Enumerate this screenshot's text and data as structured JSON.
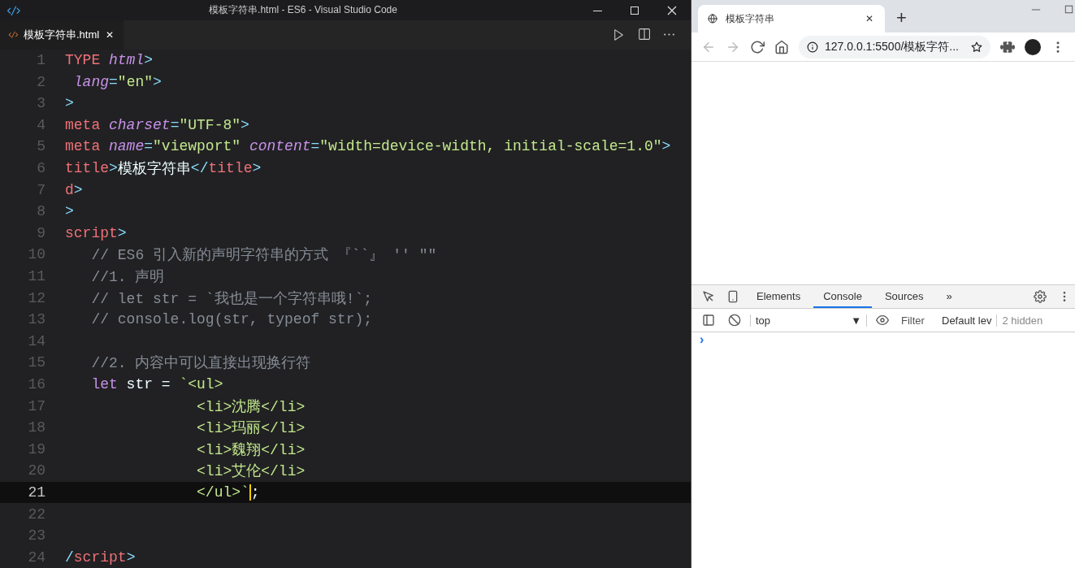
{
  "editor": {
    "window": {
      "title": "模板字符串.html - ES6 - Visual Studio Code"
    },
    "tabs": [
      {
        "label": "模板字符串.html",
        "selected": true,
        "close": "✕"
      }
    ],
    "lines": [
      {
        "number": "1",
        "current": false,
        "tokens": [
          {
            "t": "TYPE ",
            "kind": "tag"
          },
          {
            "t": "html",
            "kind": "attr"
          },
          {
            "t": ">",
            "kind": "punct"
          }
        ]
      },
      {
        "number": "2",
        "current": false,
        "tokens": [
          {
            "t": " lang",
            "kind": "attr"
          },
          {
            "t": "=",
            "kind": "punct"
          },
          {
            "t": "\"en\"",
            "kind": "string"
          },
          {
            "t": ">",
            "kind": "punct"
          }
        ]
      },
      {
        "number": "3",
        "current": false,
        "tokens": [
          {
            "t": ">",
            "kind": "punct"
          }
        ]
      },
      {
        "number": "4",
        "current": false,
        "tokens": [
          {
            "t": "meta ",
            "kind": "tag"
          },
          {
            "t": "charset",
            "kind": "attr"
          },
          {
            "t": "=",
            "kind": "punct"
          },
          {
            "t": "\"UTF-8\"",
            "kind": "string"
          },
          {
            "t": ">",
            "kind": "punct"
          }
        ]
      },
      {
        "number": "5",
        "current": false,
        "tokens": [
          {
            "t": "meta ",
            "kind": "tag"
          },
          {
            "t": "name",
            "kind": "attr"
          },
          {
            "t": "=",
            "kind": "punct"
          },
          {
            "t": "\"viewport\" ",
            "kind": "string"
          },
          {
            "t": "content",
            "kind": "attr"
          },
          {
            "t": "=",
            "kind": "punct"
          },
          {
            "t": "\"width=device-width, initial-scale=1.0\"",
            "kind": "string"
          },
          {
            "t": ">",
            "kind": "punct"
          }
        ]
      },
      {
        "number": "6",
        "current": false,
        "tokens": [
          {
            "t": "title",
            "kind": "tag"
          },
          {
            "t": ">",
            "kind": "punct"
          },
          {
            "t": "模板字符串",
            "kind": "plain"
          },
          {
            "t": "</",
            "kind": "punct"
          },
          {
            "t": "title",
            "kind": "tag"
          },
          {
            "t": ">",
            "kind": "punct"
          }
        ]
      },
      {
        "number": "7",
        "current": false,
        "tokens": [
          {
            "t": "d",
            "kind": "tag"
          },
          {
            "t": ">",
            "kind": "punct"
          }
        ]
      },
      {
        "number": "8",
        "current": false,
        "tokens": [
          {
            "t": ">",
            "kind": "punct"
          }
        ]
      },
      {
        "number": "9",
        "current": false,
        "tokens": [
          {
            "t": "script",
            "kind": "tag"
          },
          {
            "t": ">",
            "kind": "punct"
          }
        ]
      },
      {
        "number": "10",
        "current": false,
        "tokens": [
          {
            "t": "   // ES6 引入新的声明字符串的方式 『``』 '' \"\"",
            "kind": "comment"
          }
        ]
      },
      {
        "number": "11",
        "current": false,
        "tokens": [
          {
            "t": "   //1. 声明",
            "kind": "comment"
          }
        ]
      },
      {
        "number": "12",
        "current": false,
        "tokens": [
          {
            "t": "   // let str = `我也是一个字符串哦!`;",
            "kind": "comment"
          }
        ]
      },
      {
        "number": "13",
        "current": false,
        "tokens": [
          {
            "t": "   // console.log(str, typeof str);",
            "kind": "comment"
          }
        ]
      },
      {
        "number": "14",
        "current": false
      },
      {
        "number": "15",
        "current": false,
        "tokens": [
          {
            "t": "   //2. 内容中可以直接出现换行符",
            "kind": "comment"
          }
        ]
      },
      {
        "number": "16",
        "current": false,
        "tokens": [
          {
            "t": "   let",
            "kind": "keyword"
          },
          {
            "t": " str = ",
            "kind": "plain"
          },
          {
            "t": "`<ul>",
            "kind": "string"
          }
        ]
      },
      {
        "number": "17",
        "current": false,
        "tokens": [
          {
            "t": "               <li>沈腾</li>",
            "kind": "string"
          }
        ]
      },
      {
        "number": "18",
        "current": false,
        "tokens": [
          {
            "t": "               <li>玛丽</li>",
            "kind": "string"
          }
        ]
      },
      {
        "number": "19",
        "current": false,
        "tokens": [
          {
            "t": "               <li>魏翔</li>",
            "kind": "string"
          }
        ]
      },
      {
        "number": "20",
        "current": false,
        "tokens": [
          {
            "t": "               <li>艾伦</li>",
            "kind": "string"
          }
        ]
      },
      {
        "number": "21",
        "current": true,
        "tokens": [
          {
            "t": "               </ul>`",
            "kind": "string",
            "cursor_before": false
          },
          {
            "t": ";",
            "kind": "plain",
            "cursor_before": true
          }
        ]
      },
      {
        "number": "22",
        "current": false
      },
      {
        "number": "23",
        "current": false
      },
      {
        "number": "24",
        "current": false,
        "tokens": [
          {
            "t": "/",
            "kind": "punct"
          },
          {
            "t": "script",
            "kind": "tag"
          },
          {
            "t": ">",
            "kind": "punct"
          }
        ]
      }
    ]
  },
  "browser": {
    "tabs": [
      {
        "label": "模板字符串",
        "selected": true,
        "close": "✕"
      }
    ],
    "new_tab": "+",
    "address": "127.0.0.1:5500/模板字符...",
    "back_disabled": true,
    "forward_disabled": true,
    "devtools": {
      "tabs": [
        {
          "label": "Elements",
          "selected": false
        },
        {
          "label": "Console",
          "selected": true
        },
        {
          "label": "Sources",
          "selected": false
        }
      ],
      "more": "»",
      "context": "top",
      "context_arrow": "▼",
      "filter": {
        "placeholder": "Filter"
      },
      "level": "Default lev",
      "hidden": "2 hidden",
      "prompt": "›"
    }
  }
}
